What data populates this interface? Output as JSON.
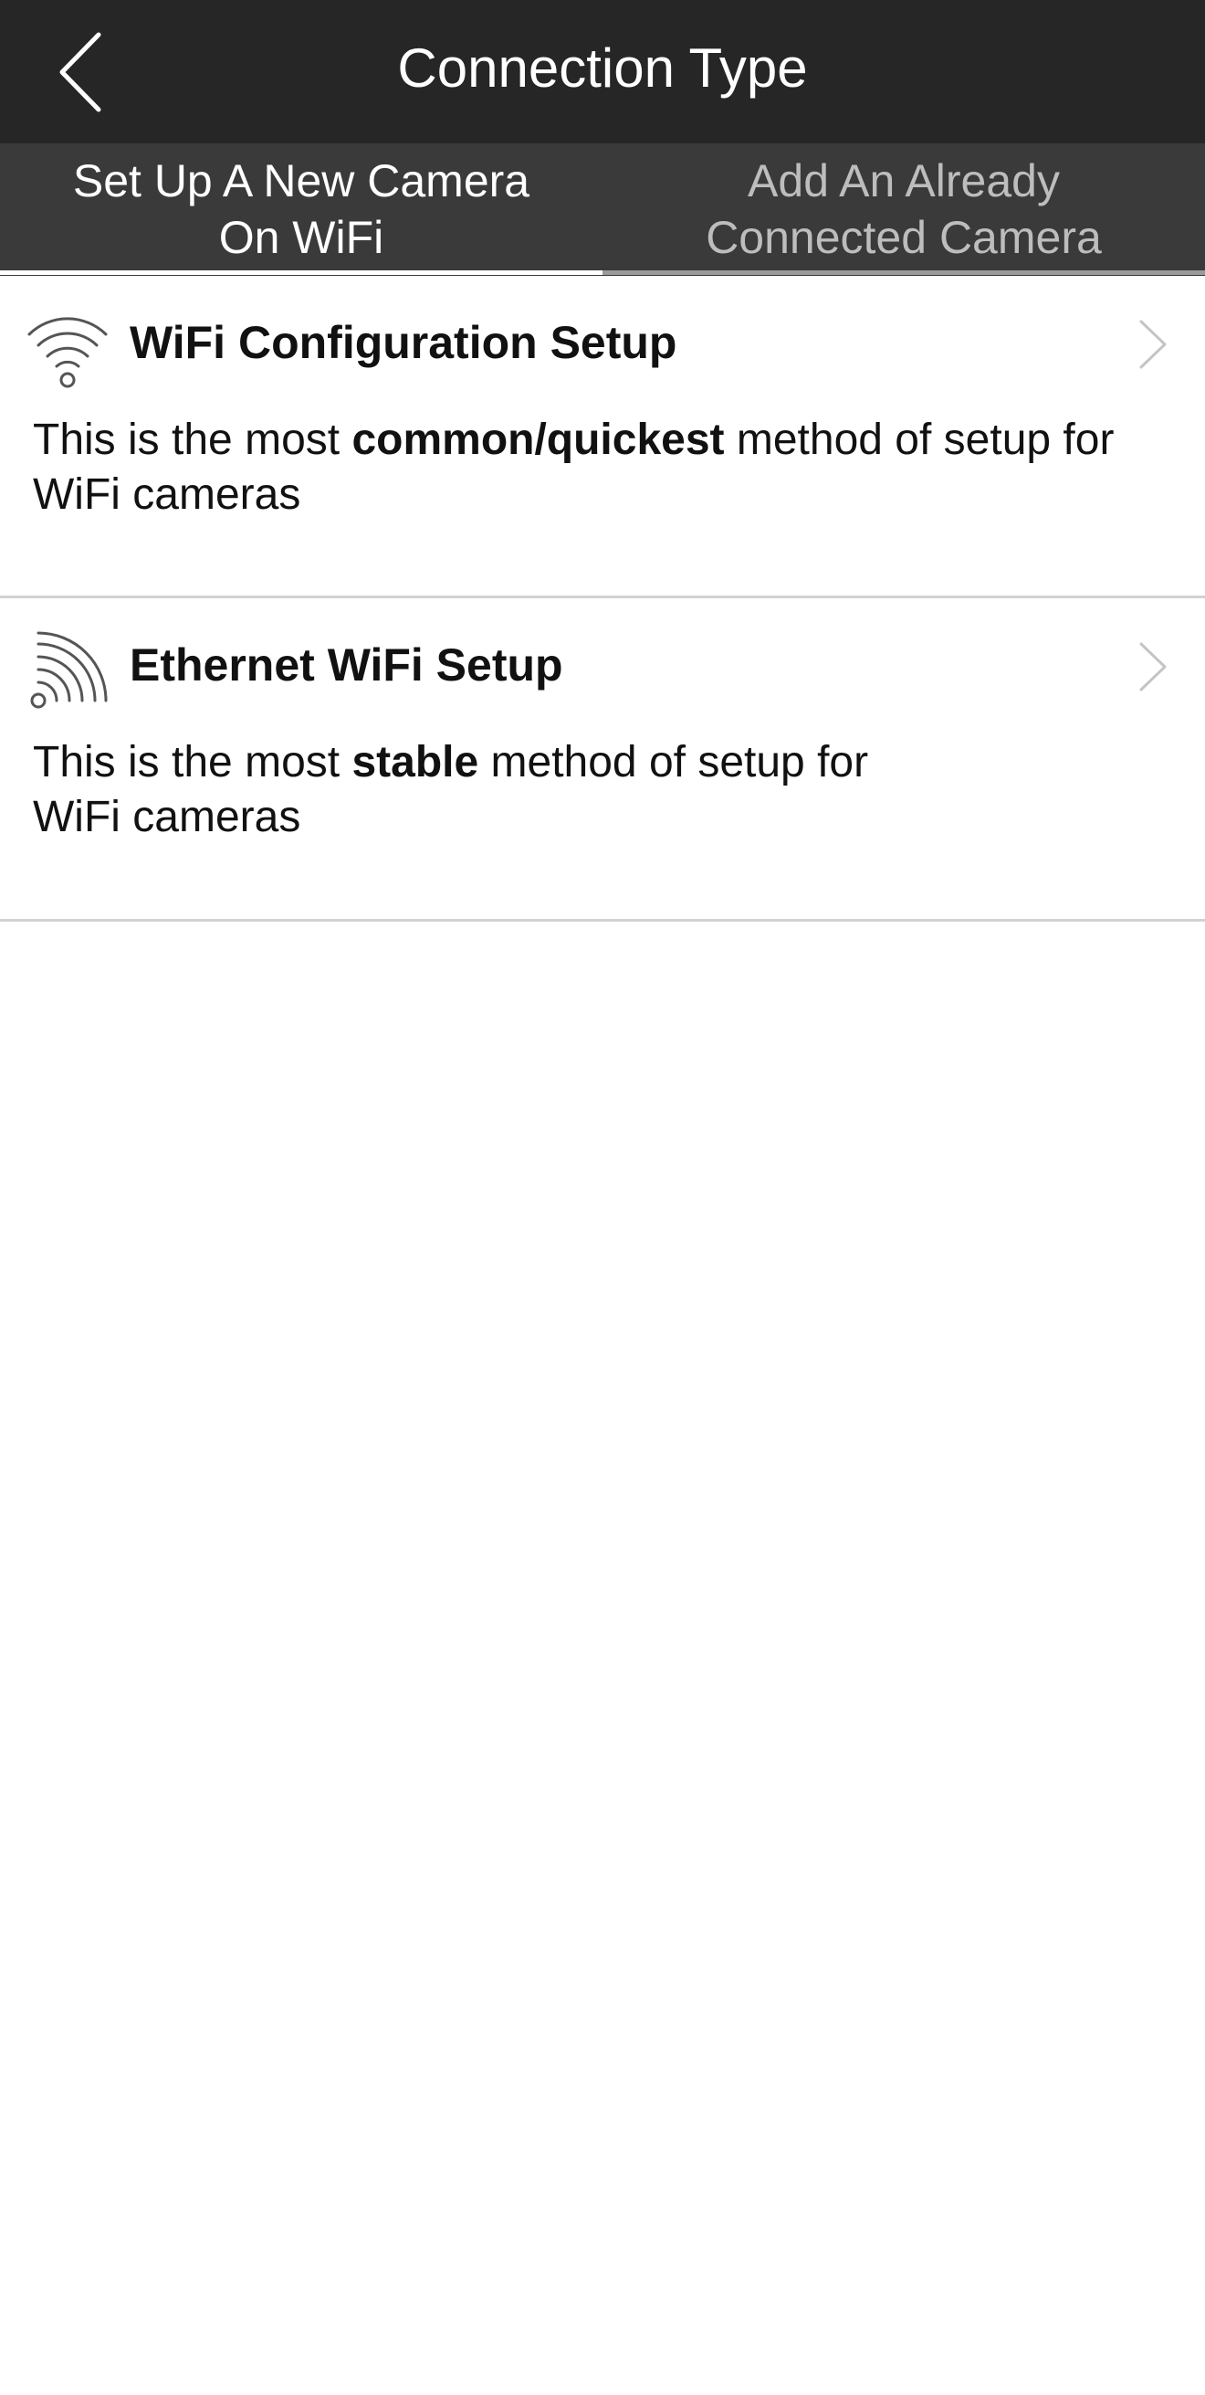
{
  "header": {
    "title": "Connection Type",
    "back_icon": "chevron-left-icon"
  },
  "tabs": [
    {
      "label_line1": "Set Up A New Camera",
      "label_line2": "On WiFi",
      "active": true
    },
    {
      "label_line1": "Add An Already",
      "label_line2": "Connected Camera",
      "active": false
    }
  ],
  "options": [
    {
      "icon": "wifi-icon",
      "title": "WiFi Configuration Setup",
      "desc_before": "This is the most ",
      "desc_bold": "common/quickest",
      "desc_after": " method of setup for",
      "desc_line2": "WiFi cameras",
      "chevron": "chevron-right-icon"
    },
    {
      "icon": "ethernet-signal-icon",
      "title": "Ethernet WiFi Setup",
      "desc_before": "This is the most ",
      "desc_bold": "stable",
      "desc_after": " method of setup for",
      "desc_line2": "WiFi cameras",
      "chevron": "chevron-right-icon"
    }
  ],
  "colors": {
    "navbar_bg": "#262626",
    "tabbar_bg": "#3a3a3a",
    "active_tab_text": "#ffffff",
    "inactive_tab_text": "#bdbdbd",
    "divider": "#d2d2d2"
  }
}
